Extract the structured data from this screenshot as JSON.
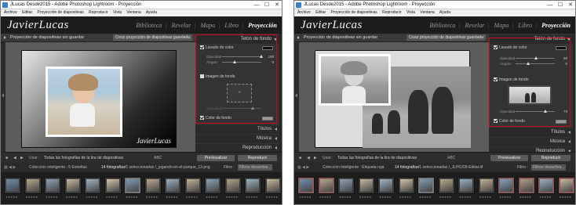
{
  "windows": [
    {
      "id": "w1",
      "title": "JLucas Desde2015 - Adobe Photoshop Lightroom - Proyección",
      "menu": [
        "Archivo",
        "Editar",
        "Proyección de diapositivas",
        "Reproducir",
        "Vista",
        "Ventana",
        "Ayuda"
      ],
      "logo": "JavierLucas",
      "modules": {
        "library": "Biblioteca",
        "develop": "Revelar",
        "map": "Mapa",
        "book": "Libro",
        "slideshow": "Proyección"
      },
      "toolbar": {
        "title": "Proyección de diapositivas sin guardar",
        "create_button": "Crear proyección de diapositivas guardada"
      },
      "slide_signature": "JavierLucas",
      "panel": {
        "backdrop_header": "Telón de fondo",
        "color_wash": "Lavado de color",
        "opacity_label": "Opacidad",
        "opacity_value": "100",
        "opacity_fraction": 1.0,
        "angle_label": "Ángulo",
        "angle_value": "0",
        "angle_fraction": 0.3,
        "background_image": "Imagen de fondo",
        "bg_image_enabled": false,
        "bg_opacity_label": "Opacidad",
        "bg_opacity_fraction": 0.75,
        "background_color": "Color de fondo",
        "titles": "Títulos",
        "music": "Música",
        "playback": "Reproducción"
      },
      "bottom": {
        "use": "Usar :",
        "use_value": "Todas las fotografías de la tira de diapositivas",
        "abc": "ABC",
        "preview_button": "Previsualizar",
        "play_button": "Reproducir"
      },
      "filmbar": {
        "collection": "Colección inteligente : 5 Estrellas",
        "count": "14 fotografías",
        "selection": "/1 seleccionadas /_jugando-en-el-parque_13.png",
        "filter_label": "Filtro :",
        "filter_value": "Filtros desactiva..."
      },
      "colors": {
        "wash_swatch": "#111111",
        "bg_swatch": "#999999"
      }
    },
    {
      "id": "w2",
      "title": "JLucas Desde2015 - Adobe Photoshop Lightroom - Proyección",
      "menu": [
        "Archivo",
        "Editar",
        "Proyección de diapositivas",
        "Reproducir",
        "Vista",
        "Ventana",
        "Ayuda"
      ],
      "logo": "JavierLucas",
      "modules": {
        "library": "Biblioteca",
        "develop": "Revelar",
        "map": "Mapa",
        "book": "Libro",
        "slideshow": "Proyección"
      },
      "toolbar": {
        "title": "Proyección de diapositivas sin guardar",
        "create_button": "Crear proyección de diapositivas guardada"
      },
      "slide_signature": "",
      "panel": {
        "backdrop_header": "Telón de fondo",
        "color_wash": "Lavado de color",
        "opacity_label": "Opacidad",
        "opacity_value": "50",
        "opacity_fraction": 0.5,
        "angle_label": "Ángulo",
        "angle_value": "0",
        "angle_fraction": 0.3,
        "background_image": "Imagen de fondo",
        "bg_image_enabled": true,
        "bg_opacity_label": "Opacidad",
        "bg_opacity_value": "73",
        "bg_opacity_fraction": 0.73,
        "background_color": "Color de fondo",
        "titles": "Títulos",
        "music": "Música",
        "playback": "Reproducción"
      },
      "bottom": {
        "use": "Usar :",
        "use_value": "Todas las fotografías de la tira de diapositivas",
        "abc": "ABC",
        "preview_button": "Previsualizar",
        "play_button": "Reproducir"
      },
      "filmbar": {
        "collection": "Colección inteligente : Etiqueta roja",
        "count": "14 fotografías",
        "selection": "/1 seleccionadas /_JLP6209-Editar.tif",
        "filter_label": "Filtro :",
        "filter_value": "Filtros desactiva..."
      },
      "colors": {
        "wash_swatch": "#111111",
        "bg_swatch": "#999999"
      }
    }
  ],
  "icons": {
    "minimize": "minimize-icon",
    "maximize": "maximize-icon",
    "close": "close-icon"
  },
  "tb_glyphs": {
    "min": "—",
    "max": "☐",
    "close": "✕"
  }
}
